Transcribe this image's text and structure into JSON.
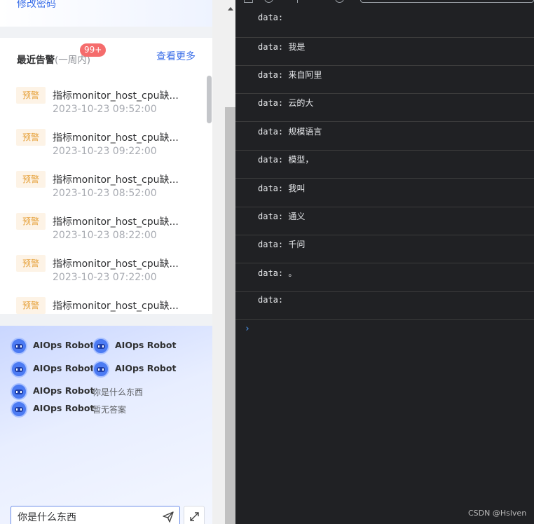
{
  "top_card": {
    "link": "修改密码"
  },
  "alarm": {
    "title": "最近告警",
    "subtitle": "(一周内)",
    "badge": "99+",
    "more": "查看更多",
    "items": [
      {
        "tag": "预警",
        "text": "指标monitor_host_cpu缺...",
        "time": "2023-10-23 09:52:00"
      },
      {
        "tag": "预警",
        "text": "指标monitor_host_cpu缺...",
        "time": "2023-10-23 09:22:00"
      },
      {
        "tag": "预警",
        "text": "指标monitor_host_cpu缺...",
        "time": "2023-10-23 08:52:00"
      },
      {
        "tag": "预警",
        "text": "指标monitor_host_cpu缺...",
        "time": "2023-10-23 08:22:00"
      },
      {
        "tag": "预警",
        "text": "指标monitor_host_cpu缺...",
        "time": "2023-10-23 07:22:00"
      },
      {
        "tag": "预警",
        "text": "指标monitor_host_cpu缺...",
        "time": ""
      }
    ]
  },
  "chat": {
    "robot_name": "AIOps Robot",
    "messages": [
      {
        "name": "AIOps Robot",
        "text": ""
      },
      {
        "name": "AIOps Robot",
        "text": ""
      },
      {
        "name": "AIOps Robot",
        "text": ""
      },
      {
        "name": "AIOps Robot",
        "text": ""
      },
      {
        "name": "AIOps Robot",
        "text": "你是什么东西"
      },
      {
        "name": "AIOps Robot",
        "text": "暂无答案"
      }
    ],
    "input_value": "你是什么东西"
  },
  "console": {
    "logs": [
      "data:",
      "data: 我是",
      "data: 来自阿里",
      "data: 云的大",
      "data: 规模语言",
      "data: 模型，",
      "data: 我叫",
      "data: 通义",
      "data: 千问",
      "data: 。",
      "data:"
    ],
    "prompt": "›"
  },
  "watermark": "CSDN @Hslven",
  "colors": {
    "accent": "#3a6ee8",
    "badge": "#f56c6c",
    "warn_tag": "#e6a23c",
    "console_bg": "#202124"
  }
}
